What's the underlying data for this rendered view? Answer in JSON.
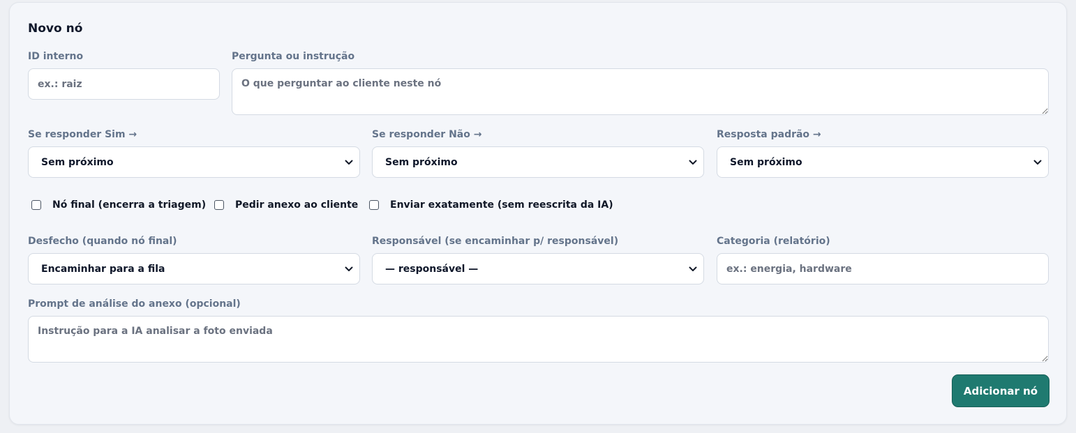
{
  "form": {
    "title": "Novo nó",
    "id_label": "ID interno",
    "id_placeholder": "ex.: raiz",
    "question_label": "Pergunta ou instrução",
    "question_placeholder": "O que perguntar ao cliente neste nó",
    "yes_label": "Se responder Sim →",
    "yes_value": "Sem próximo",
    "no_label": "Se responder Não →",
    "no_value": "Sem próximo",
    "default_label": "Resposta padrão →",
    "default_value": "Sem próximo",
    "final_node_label": "Nó final (encerra a triagem)",
    "ask_attachment_label": "Pedir anexo ao cliente",
    "send_exact_label": "Enviar exatamente (sem reescrita da IA)",
    "outcome_label": "Desfecho (quando nó final)",
    "outcome_value": "Encaminhar para a fila",
    "owner_label": "Responsável (se encaminhar p/ responsável)",
    "owner_value": "— responsável —",
    "category_label": "Categoria (relatório)",
    "category_placeholder": "ex.: energia, hardware",
    "prompt_label": "Prompt de análise do anexo (opcional)",
    "prompt_placeholder": "Instrução para a IA analisar a foto enviada",
    "submit_label": "Adicionar nó"
  },
  "colors": {
    "accent": "#1f7a70",
    "label": "#64748b",
    "card_bg": "#f4f6fa"
  },
  "icons": {
    "select_arrow": "chevron-down-icon"
  }
}
